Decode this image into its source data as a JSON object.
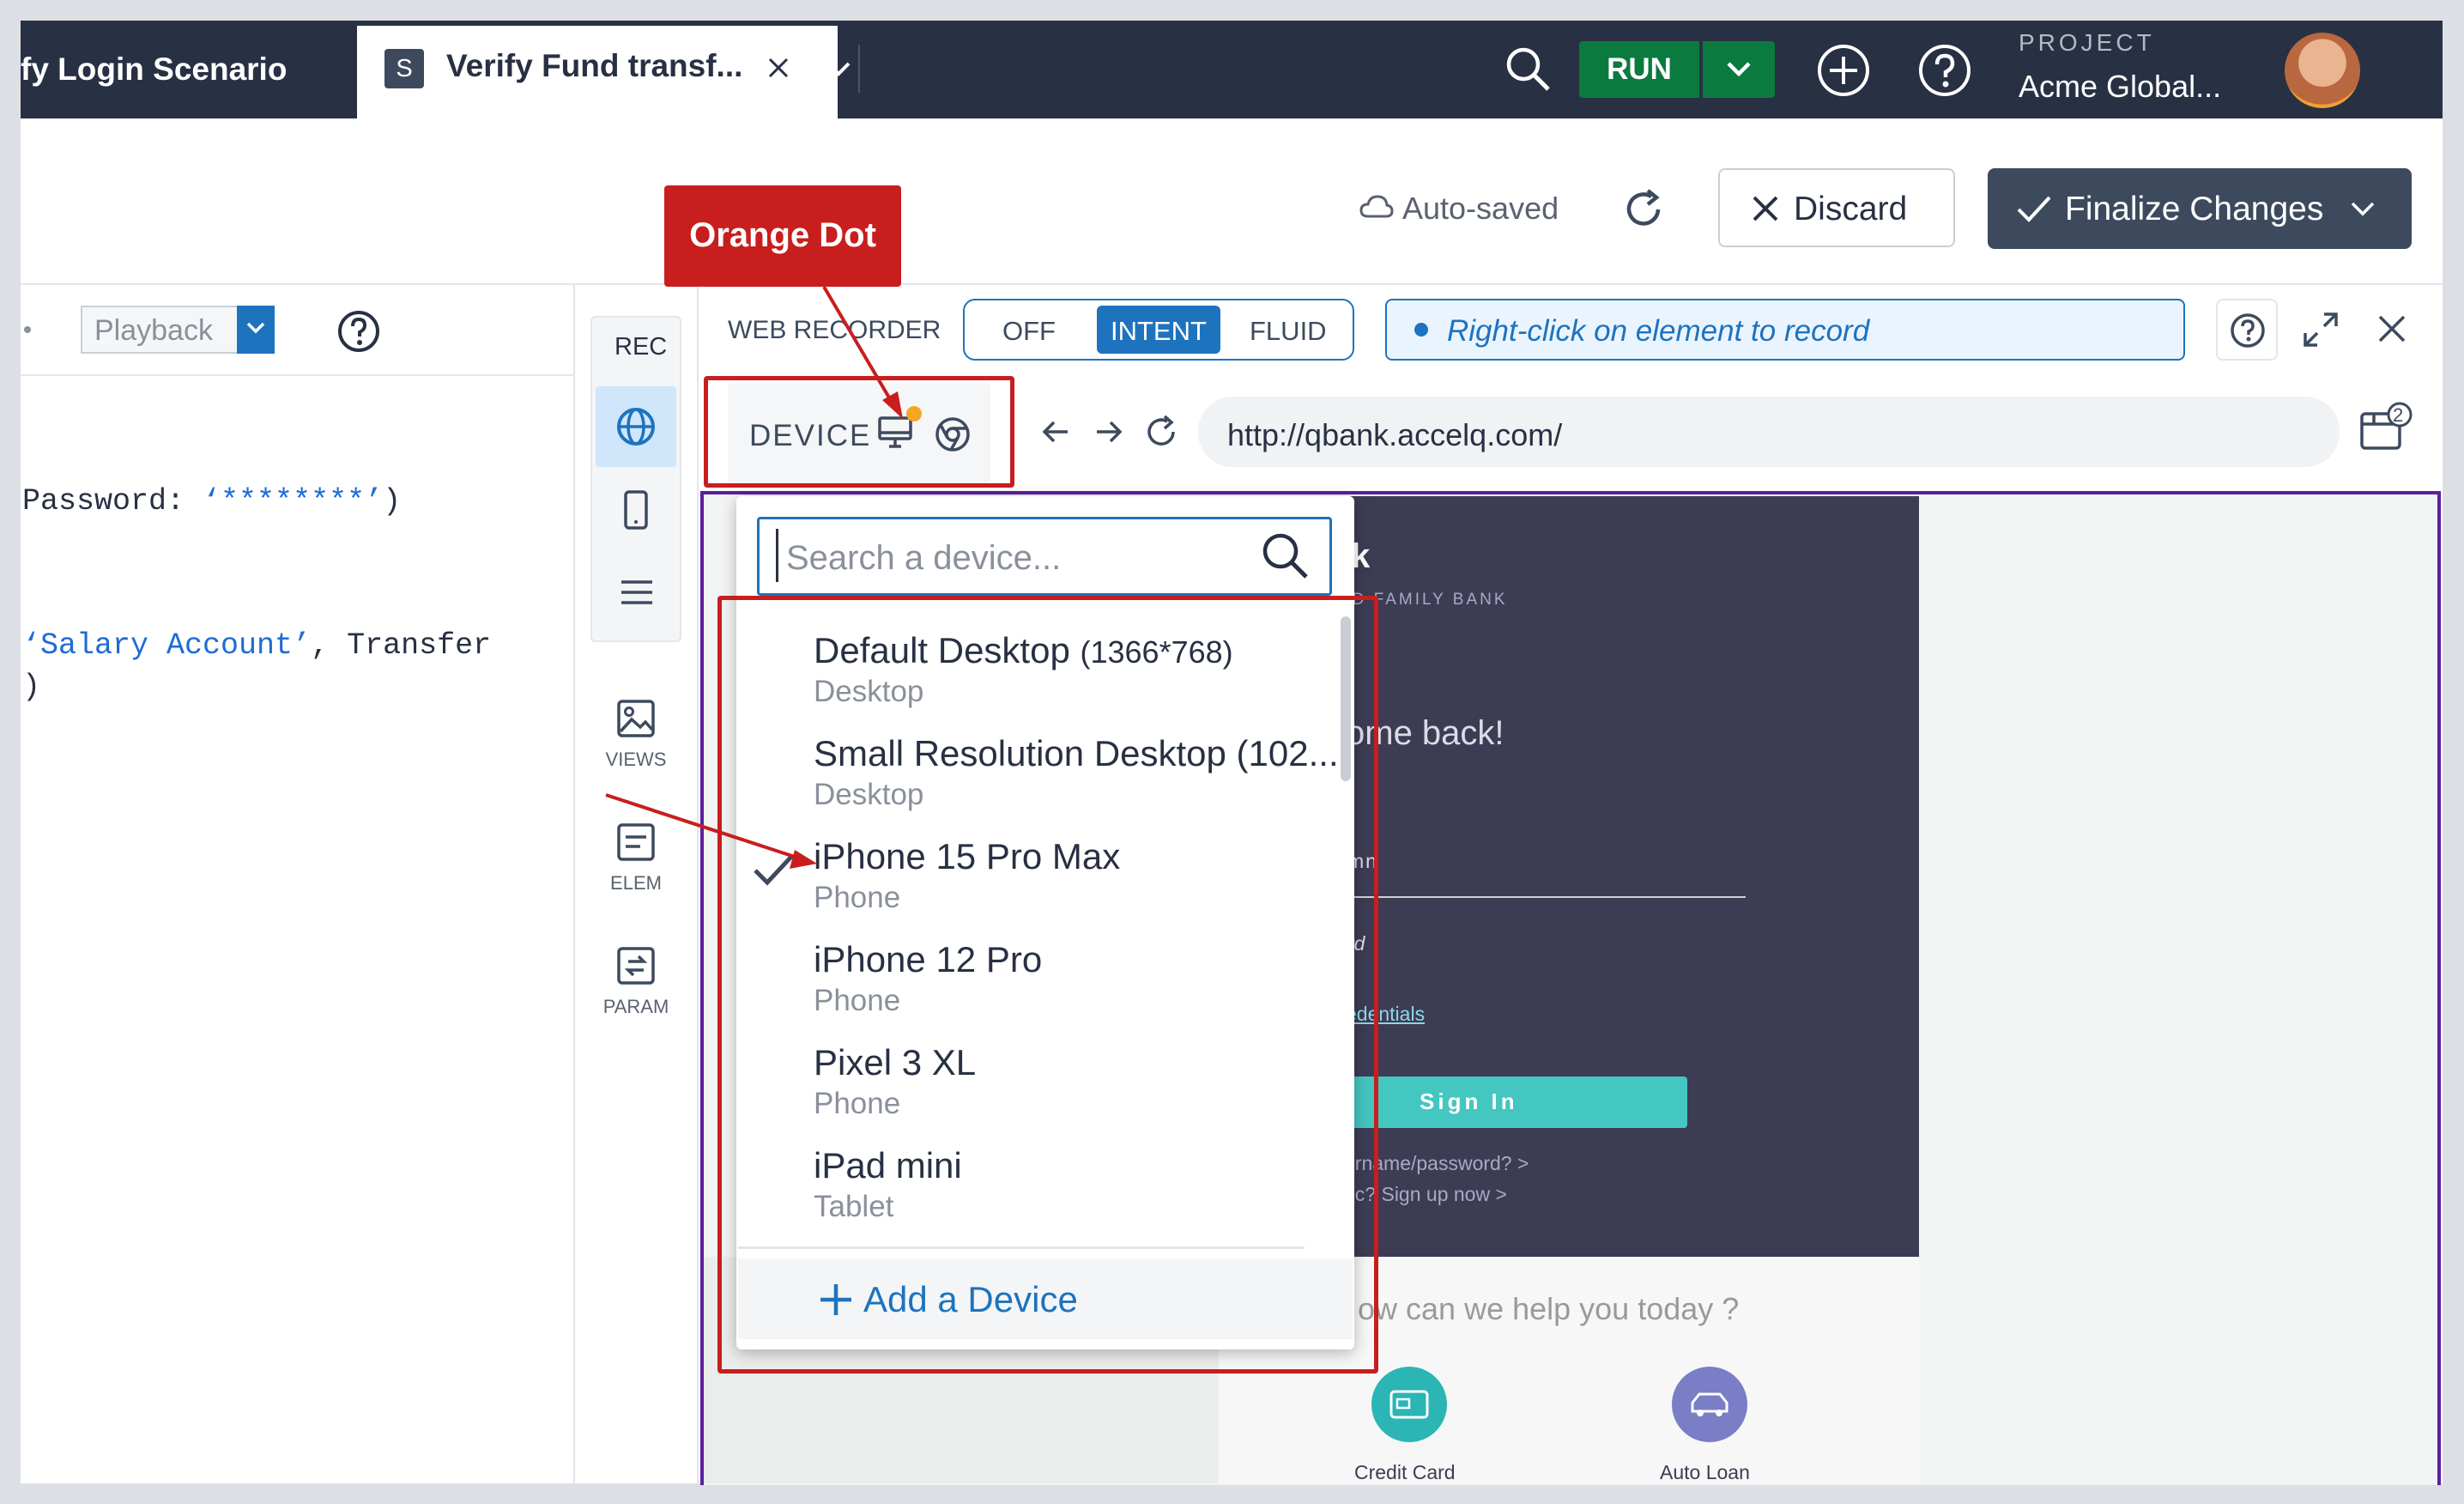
{
  "header": {
    "tab_scenario": "fy Login Scenario",
    "tab_active_badge": "S",
    "tab_active": "Verify Fund transf...",
    "run_label": "RUN",
    "project_caption": "PROJECT",
    "project_name": "Acme Global..."
  },
  "editor_toolbar": {
    "autosaved": "Auto-saved",
    "discard": "Discard",
    "finalize": "Finalize Changes"
  },
  "code_panel": {
    "mode_select": "Playback",
    "lines": [
      {
        "plain_pre": "Password: ",
        "string": "‘********’",
        "plain_post": ")"
      },
      {
        "plain_pre": "",
        "string": "‘Salary Account’",
        "plain_post": ", Transfer"
      },
      {
        "plain_pre": ")",
        "string": "",
        "plain_post": ""
      }
    ]
  },
  "tool_rail": {
    "rec": "REC",
    "views": "VIEWS",
    "elem": "ELEM",
    "param": "PARAM"
  },
  "recorder": {
    "title": "WEB RECORDER",
    "modes": [
      "OFF",
      "INTENT",
      "FLUID"
    ],
    "active_mode": "INTENT",
    "hint": "Right-click on element to record",
    "device_label": "DEVICE",
    "url": "http://qbank.accelq.com/",
    "tabs_count": "2"
  },
  "device_dropdown": {
    "search_placeholder": "Search a device...",
    "devices": [
      {
        "name": "Default Desktop",
        "resolution": "(1366*768)",
        "type": "Desktop",
        "selected": false
      },
      {
        "name": "Small Resolution Desktop (102...",
        "resolution": "",
        "type": "Desktop",
        "selected": false
      },
      {
        "name": "iPhone 15 Pro Max",
        "resolution": "",
        "type": "Phone",
        "selected": true
      },
      {
        "name": "iPhone 12 Pro",
        "resolution": "",
        "type": "Phone",
        "selected": false
      },
      {
        "name": "Pixel 3 XL",
        "resolution": "",
        "type": "Phone",
        "selected": false
      },
      {
        "name": "iPad mini",
        "resolution": "",
        "type": "Tablet",
        "selected": false
      }
    ],
    "add_device": "Add a Device"
  },
  "site_preview": {
    "logo_fragment": "k",
    "tagline_fragment": "ED FAMILY BANK",
    "welcome_fragment": "ome back!",
    "username_fragment": "mn",
    "password_fragment": "rd",
    "credentials_fragment": "edentials",
    "sign_in": "Sign In",
    "forgot_fragment": "ername/password?  >",
    "signup_fragment": "ec? Sign up now  >",
    "help_fragment": "ow can we help you today ?",
    "service_credit": "Credit Card",
    "service_auto": "Auto Loan"
  },
  "annotation": {
    "callout": "Orange Dot"
  },
  "colors": {
    "topbar": "#283043",
    "run_green": "#0b7a3f",
    "accent_blue": "#1e73be",
    "annotation_red": "#c81e1e",
    "orange_dot": "#f5a623",
    "viewport_border": "#5a1fa0"
  }
}
